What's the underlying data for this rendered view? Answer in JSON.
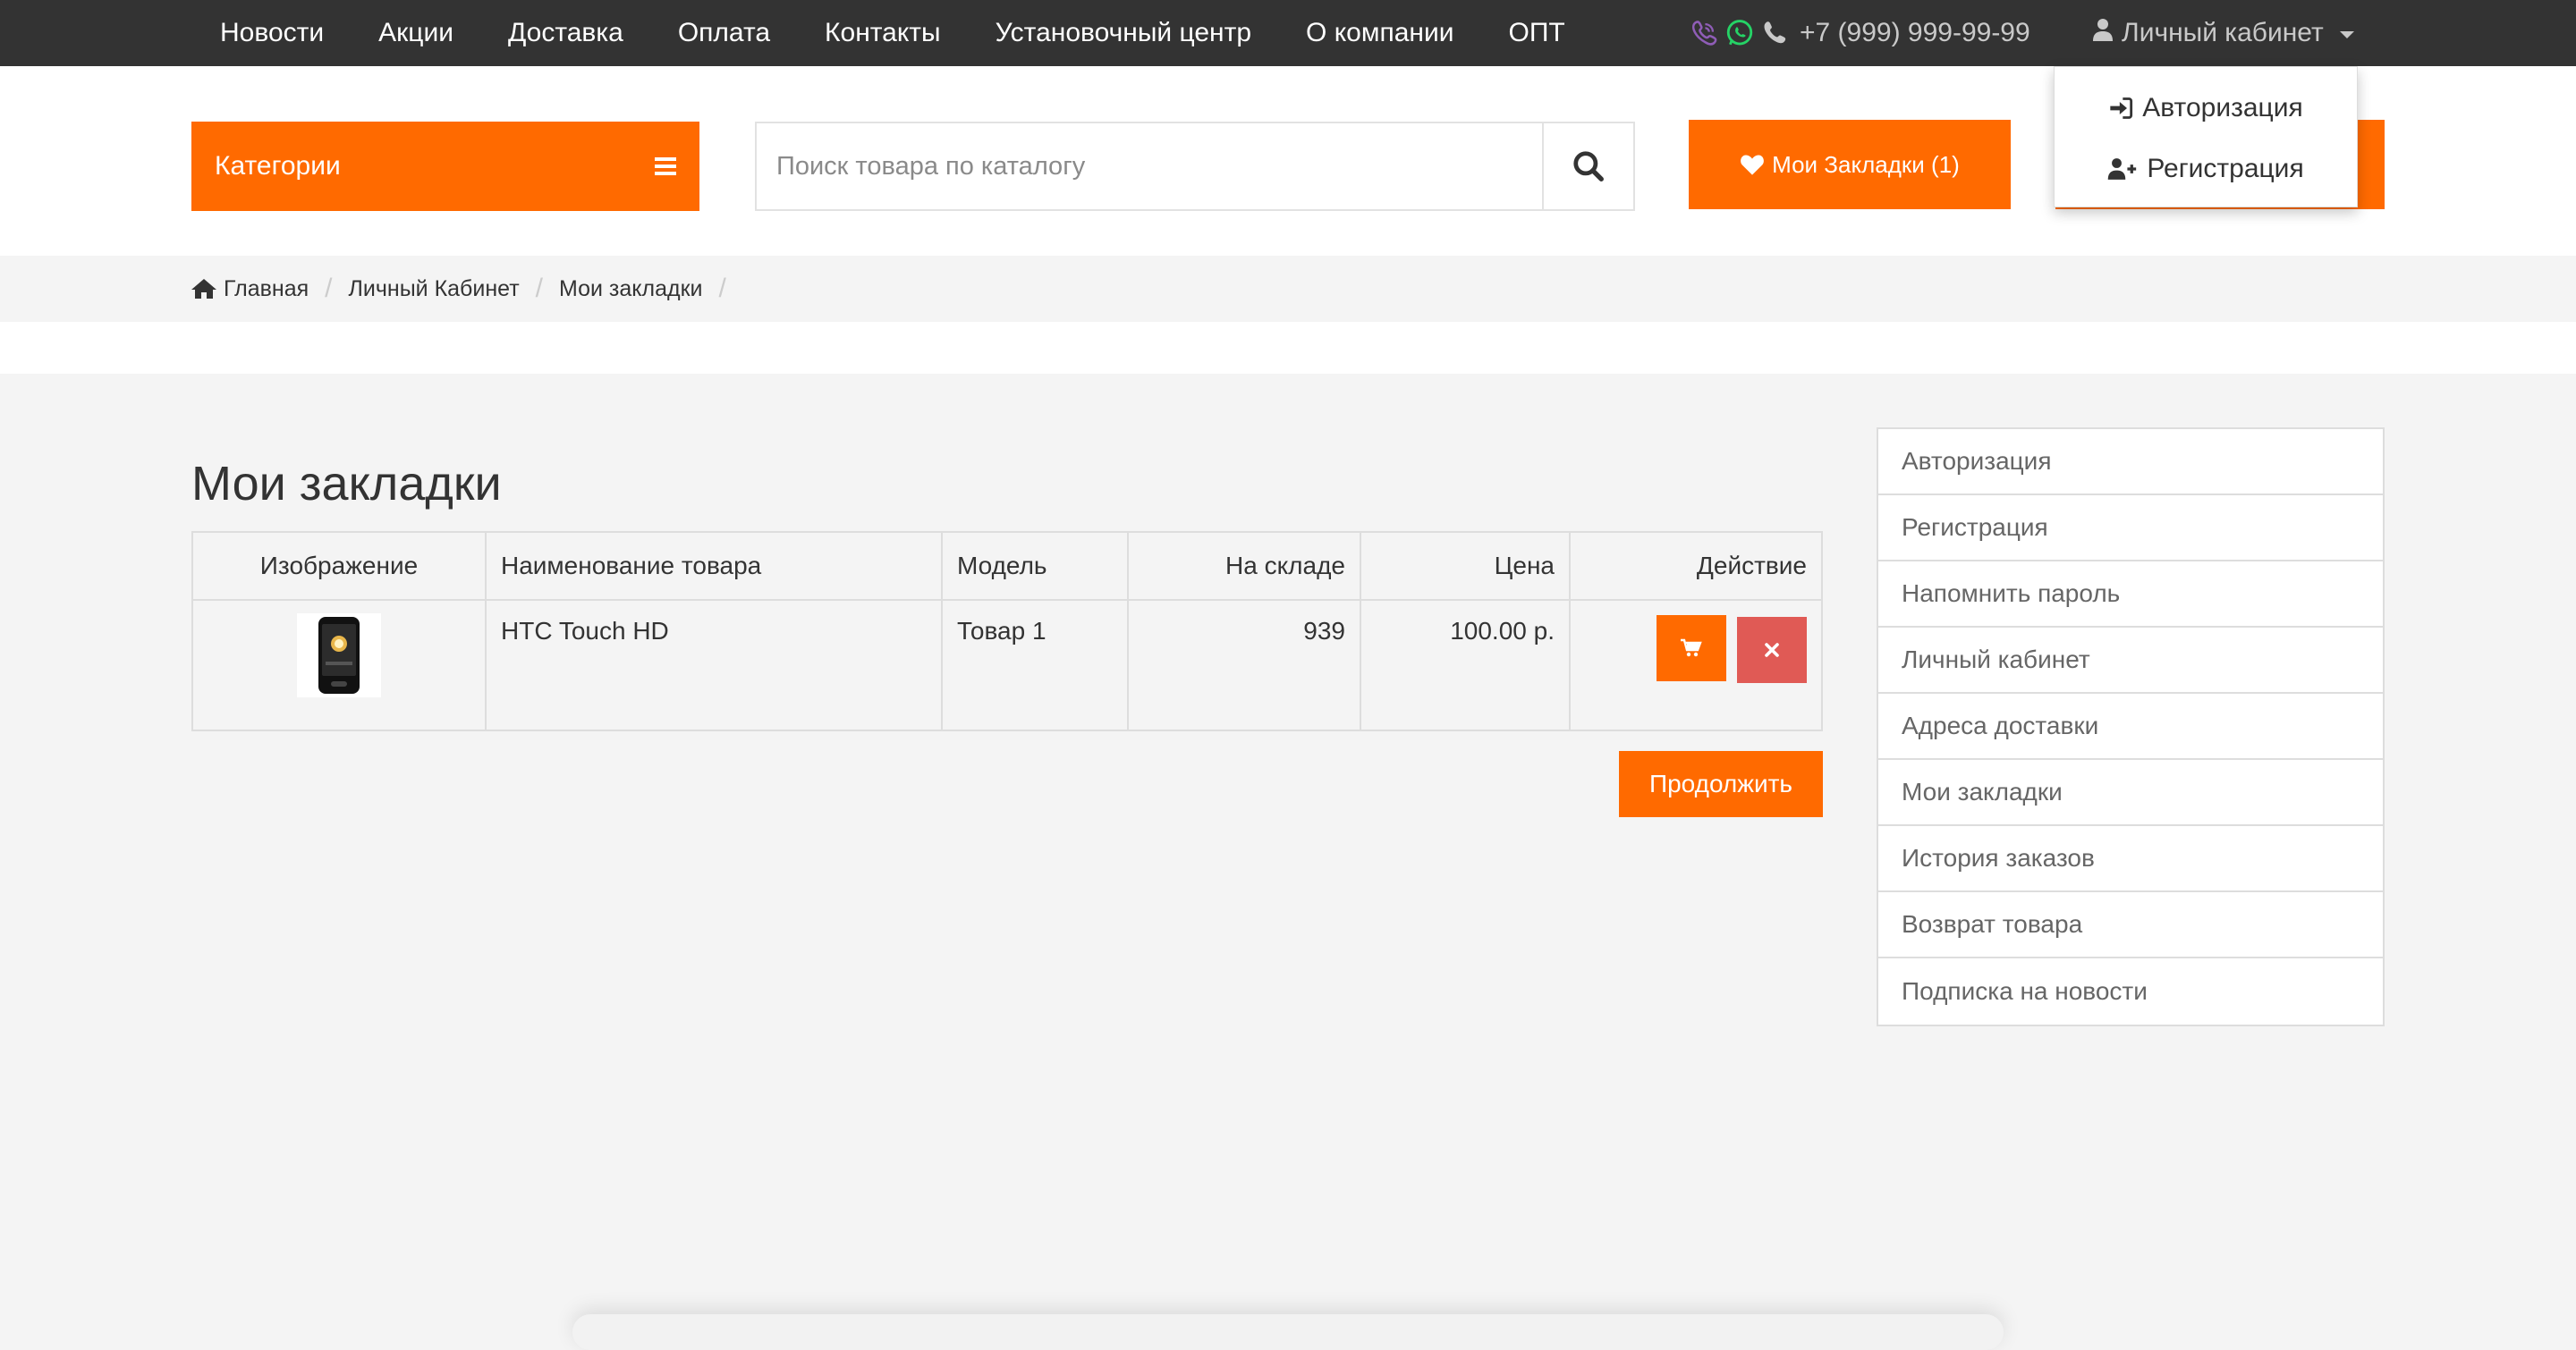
{
  "topnav": [
    "Новости",
    "Акции",
    "Доставка",
    "Оплата",
    "Контакты",
    "Установочный центр",
    "О компании",
    "ОПТ"
  ],
  "contacts": {
    "phone": "+7 (999) 999-99-99"
  },
  "account": {
    "label": "Личный кабинет",
    "dropdown": [
      "Авторизация",
      "Регистрация"
    ]
  },
  "header": {
    "categories_label": "Категории",
    "search_placeholder": "Поиск товара по каталогу",
    "wishlist_label": "Мои Закладки (1)"
  },
  "breadcrumb": [
    "Главная",
    "Личный Кабинет",
    "Мои закладки"
  ],
  "page_title": "Мои закладки",
  "table": {
    "headers": [
      "Изображение",
      "Наименование товара",
      "Модель",
      "На складе",
      "Цена",
      "Действие"
    ],
    "rows": [
      {
        "name": "HTC Touch HD",
        "model": "Товар 1",
        "stock": "939",
        "price": "100.00 р."
      }
    ]
  },
  "continue_label": "Продолжить",
  "sidebar": [
    "Авторизация",
    "Регистрация",
    "Напомнить пароль",
    "Личный кабинет",
    "Адреса доставки",
    "Мои закладки",
    "История заказов",
    "Возврат товара",
    "Подписка на новости"
  ],
  "colors": {
    "accent": "#ff6a00",
    "danger": "#e05a55",
    "topbar": "#333333"
  }
}
